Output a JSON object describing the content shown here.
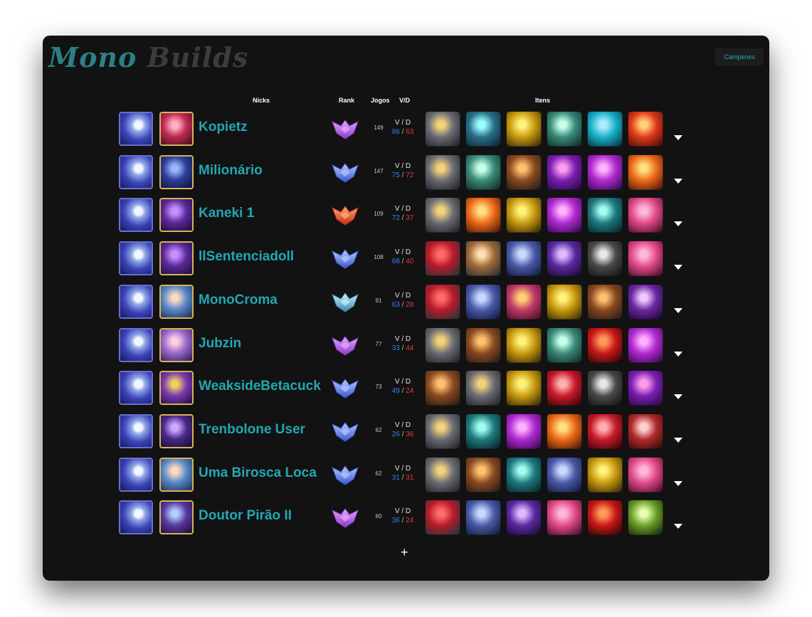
{
  "header": {
    "logo_part1": "Mono",
    "logo_part2": "Builds",
    "champions_button": "Campeoes"
  },
  "columns": {
    "nicks": "Nicks",
    "rank": "Rank",
    "jogos": "Jogos",
    "vd": "V/D",
    "itens": "Itens"
  },
  "vd_label": "V / D",
  "add_label": "+",
  "rows": [
    {
      "nick": "Kopietz",
      "jogos": "149",
      "wins": "86",
      "losses": "63",
      "rank": "amethyst",
      "champ": [
        "#ffb2c4",
        "#c02a52",
        "#3a0b1a"
      ],
      "items": [
        "boots",
        "cyan",
        "gold",
        "teal",
        "cyanice",
        "fire"
      ]
    },
    {
      "nick": "Milionário",
      "jogos": "147",
      "wins": "75",
      "losses": "72",
      "rank": "blue",
      "champ": [
        "#9ab6ff",
        "#2e3f9a",
        "#0a1030"
      ],
      "items": [
        "boots",
        "teal",
        "bronze",
        "violet",
        "magenta",
        "orange"
      ]
    },
    {
      "nick": "Kaneki 1",
      "jogos": "109",
      "wins": "72",
      "losses": "37",
      "rank": "red",
      "champ": [
        "#c890ff",
        "#5a2a9a",
        "#1c0a32"
      ],
      "items": [
        "boots",
        "orange",
        "gold",
        "magenta",
        "tealdark",
        "pink"
      ]
    },
    {
      "nick": "llSentenciadoll",
      "jogos": "108",
      "wins": "68",
      "losses": "40",
      "rank": "blue",
      "champ": [
        "#c890ff",
        "#5a2a9a",
        "#1c0a32"
      ],
      "items": [
        "crimson",
        "tan",
        "navy",
        "purple",
        "gray",
        "pink"
      ]
    },
    {
      "nick": "MonoCroma",
      "jogos": "91",
      "wins": "63",
      "losses": "28",
      "rank": "steel",
      "champ": [
        "#ffd9c0",
        "#5a8acc",
        "#1a2a48"
      ],
      "items": [
        "crimson",
        "navy",
        "rose",
        "gold",
        "bronze",
        "violetdeep"
      ]
    },
    {
      "nick": "Jubzin",
      "jogos": "77",
      "wins": "33",
      "losses": "44",
      "rank": "amethyst",
      "champ": [
        "#ffd0e0",
        "#9b6ad0",
        "#2a1a4a"
      ],
      "items": [
        "boots",
        "bronze",
        "gold",
        "teal",
        "redfire",
        "magenta"
      ]
    },
    {
      "nick": "WeaksideBetacuck",
      "jogos": "73",
      "wins": "49",
      "losses": "24",
      "rank": "blue",
      "champ": [
        "#f0d060",
        "#7a3ab0",
        "#220a38"
      ],
      "items": [
        "bronze",
        "boots",
        "gold",
        "redblade",
        "gray",
        "violet"
      ]
    },
    {
      "nick": "Trenbolone User",
      "jogos": "62",
      "wins": "26",
      "losses": "36",
      "rank": "blue",
      "champ": [
        "#d0a8ff",
        "#4a2a8a",
        "#14082a"
      ],
      "items": [
        "boots",
        "tealdark",
        "magenta",
        "orange",
        "redblade",
        "redmetal"
      ]
    },
    {
      "nick": "Uma Birosca Loca",
      "jogos": "62",
      "wins": "31",
      "losses": "31",
      "rank": "blue",
      "champ": [
        "#ffd9c0",
        "#5a8acc",
        "#1a2a48"
      ],
      "items": [
        "boots",
        "bronze",
        "tealdark",
        "navy",
        "gold",
        "pink"
      ]
    },
    {
      "nick": "Doutor Pirão II",
      "jogos": "60",
      "wins": "36",
      "losses": "24",
      "rank": "amethyst",
      "champ": [
        "#b0d0ff",
        "#5a3aa0",
        "#180a30"
      ],
      "items": [
        "crimson",
        "navy",
        "purple",
        "pink",
        "redfire",
        "lime"
      ]
    }
  ],
  "item_colors": {
    "boots": [
      "#f2d27a",
      "#6b6b74",
      "#1c1c22"
    ],
    "cyan": [
      "#9ff",
      "#2a6f8a",
      "#0d1f2b"
    ],
    "gold": [
      "#fff27a",
      "#c99a10",
      "#2a2108"
    ],
    "teal": [
      "#c8ffe8",
      "#3a8a7a",
      "#0c2420"
    ],
    "cyanice": [
      "#aef",
      "#18b0c8",
      "#062a36"
    ],
    "fire": [
      "#ffd07a",
      "#e03a18",
      "#3a0808"
    ],
    "bronze": [
      "#ffc070",
      "#8a4a20",
      "#1a1818"
    ],
    "violet": [
      "#ff9cf0",
      "#7a1fb0",
      "#200838"
    ],
    "magenta": [
      "#ffb0ff",
      "#b02ad0",
      "#2a0840"
    ],
    "orange": [
      "#ffe080",
      "#ee6a18",
      "#3a1208"
    ],
    "tealdark": [
      "#a0fff0",
      "#1e7a80",
      "#081c22"
    ],
    "pink": [
      "#ffb8d8",
      "#e24a8a",
      "#3a0a20"
    ],
    "crimson": [
      "#ff6a6a",
      "#b81a2a",
      "#0f3a3a"
    ],
    "tan": [
      "#ffe0b0",
      "#a06a38",
      "#1a2a3a"
    ],
    "navy": [
      "#c8d8ff",
      "#4a5aa8",
      "#0e1430"
    ],
    "purple": [
      "#e0b8ff",
      "#5a2aa0",
      "#14082a"
    ],
    "gray": [
      "#e8e8e8",
      "#4a4a4a",
      "#0e0e0e"
    ],
    "rose": [
      "#ffd070",
      "#c03a6a",
      "#3a0a20"
    ],
    "violetdeep": [
      "#f0c8ff",
      "#6a28a0",
      "#14042a"
    ],
    "redfire": [
      "#ff9a5a",
      "#c81818",
      "#1a0404"
    ],
    "redblade": [
      "#ffb0b0",
      "#c81a2a",
      "#2a0408"
    ],
    "redmetal": [
      "#ffd0d0",
      "#b02a2a",
      "#2a0808"
    ],
    "lime": [
      "#e8ffb0",
      "#6aa02a",
      "#0e1a08"
    ]
  },
  "rank_colors": {
    "amethyst": [
      "#e8a8ff",
      "#8a3ac8"
    ],
    "blue": [
      "#b8c8ff",
      "#3a5ad0"
    ],
    "red": [
      "#ffb070",
      "#c8281a"
    ],
    "steel": [
      "#c8f0ff",
      "#3a8ab0"
    ]
  }
}
